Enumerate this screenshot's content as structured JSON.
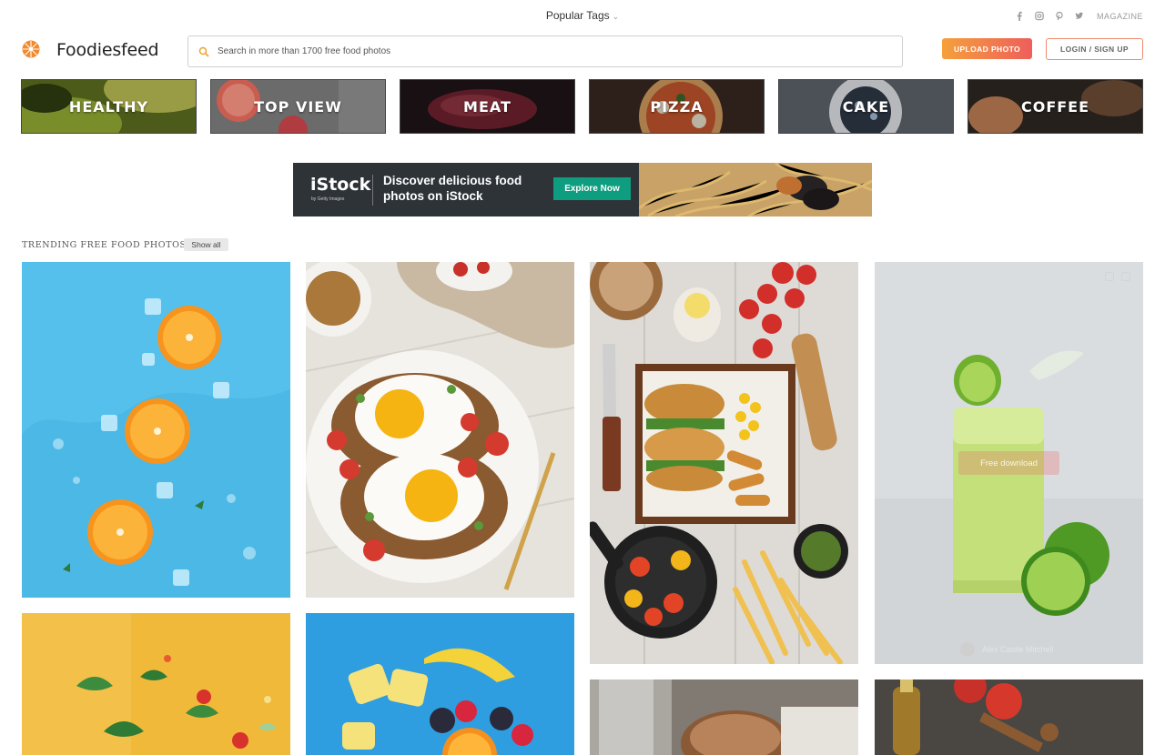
{
  "topbar": {
    "popular_tags": "Popular Tags",
    "social_icons": [
      "facebook-icon",
      "instagram-icon",
      "pinterest-icon",
      "twitter-icon"
    ],
    "magazine": "MAGAZINE"
  },
  "header": {
    "logo_text": "Foodiesfeed",
    "search_placeholder": "Search in more than 1700 free food photos",
    "upload_label": "UPLOAD PHOTO",
    "login_label": "LOGIN / SIGN UP"
  },
  "categories": [
    {
      "label": "HEALTHY"
    },
    {
      "label": "TOP VIEW"
    },
    {
      "label": "MEAT"
    },
    {
      "label": "PIZZA"
    },
    {
      "label": "CAKE"
    },
    {
      "label": "COFFEE"
    }
  ],
  "banner": {
    "logo": "iStock",
    "logo_sub": "by Getty Images",
    "headline": "Discover delicious food photos on iStock",
    "cta": "Explore Now"
  },
  "trending": {
    "title": "TRENDING FREE FOOD PHOTOS",
    "show_all": "Show all",
    "hover_tile": {
      "download": "Free download",
      "author": "Alex Castle Mitchell"
    }
  },
  "colors": {
    "accent_orange": "#f5a03c",
    "accent_red": "#ee5f5b",
    "banner_green": "#0f9d80"
  }
}
